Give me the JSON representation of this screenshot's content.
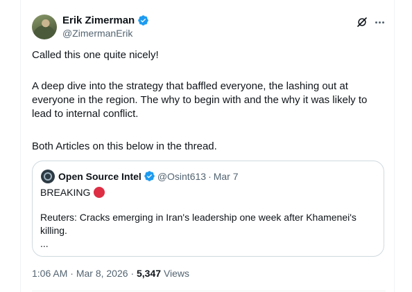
{
  "author": {
    "display_name": "Erik Zimerman",
    "handle": "@ZimermanErik"
  },
  "tweet": {
    "paragraph_1": "Called this one quite nicely!",
    "paragraph_2": "A deep dive into the strategy that baffled everyone, the lashing out at everyone in the region. The why to begin with and the why it was likely to lead to internal conflict.",
    "paragraph_3": "Both Articles on this below in the thread."
  },
  "quoted_tweet": {
    "display_name": "Open Source Intel",
    "handle": "@Osint613",
    "separator": "·",
    "date": "Mar 7",
    "breaking_text": "BREAKING",
    "body": "Reuters: Cracks emerging in Iran's leadership one week after Khamenei's killing.",
    "ellipsis": "..."
  },
  "meta": {
    "time": "1:06 AM",
    "separator": "·",
    "date": "Mar 8, 2026",
    "views_count": "5,347",
    "views_label": "Views"
  },
  "icons": {
    "verified": "verified-badge-icon",
    "grok": "grok-icon",
    "more": "more-icon"
  },
  "colors": {
    "verified_blue": "#1d9bf0",
    "secondary_text": "#536471",
    "breaking_dot": "#dd2e44"
  }
}
